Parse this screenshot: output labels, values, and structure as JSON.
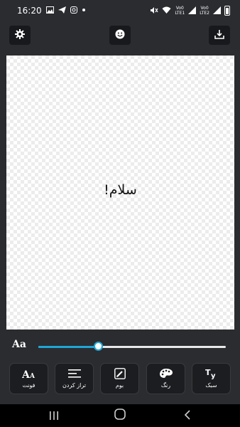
{
  "status_bar": {
    "time": "16:20",
    "sim1_top": "Vo0",
    "sim1_bottom": "LTE1",
    "sim2_top": "Vo0",
    "sim2_bottom": "LTE2"
  },
  "canvas": {
    "text": "سلام!"
  },
  "size_control": {
    "label": "Aa",
    "value_fraction": 0.32
  },
  "tools": [
    {
      "label": "فونت",
      "icon": "font-icon"
    },
    {
      "label": "تراز کردن",
      "icon": "align-icon"
    },
    {
      "label": "بوم",
      "icon": "brush-icon"
    },
    {
      "label": "رنگ",
      "icon": "palette-icon"
    },
    {
      "label": "سبک",
      "icon": "style-icon"
    }
  ],
  "colors": {
    "accent": "#1fa6d6",
    "background": "#2b2c30",
    "button": "#1c1d20"
  }
}
